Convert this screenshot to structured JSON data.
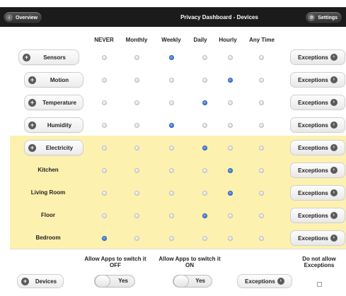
{
  "header": {
    "back_label": "Overview",
    "title": "Privacy Dashboard - Devices",
    "settings_label": "Settings"
  },
  "columns": [
    "NEVER",
    "Monthly",
    "Weekly",
    "Daily",
    "Hourly",
    "Any Time"
  ],
  "rows": [
    {
      "label": "Sensors",
      "style": "button",
      "selected": 2,
      "exceptions": "Exceptions"
    },
    {
      "label": "Motion",
      "style": "button",
      "selected": 4,
      "exceptions": "Exceptions"
    },
    {
      "label": "Temperature",
      "style": "button",
      "selected": 3,
      "exceptions": "Exceptions"
    },
    {
      "label": "Humidity",
      "style": "button",
      "selected": 2,
      "exceptions": "Exceptions"
    },
    {
      "label": "Electricity",
      "style": "button",
      "selected": 3,
      "exceptions": "Exceptions"
    },
    {
      "label": "Kitchen",
      "style": "plain",
      "selected": 4,
      "exceptions": "Exceptions"
    },
    {
      "label": "Living Room",
      "style": "plain",
      "selected": 4,
      "exceptions": "Exceptions"
    },
    {
      "label": "Floor",
      "style": "plain",
      "selected": 3,
      "exceptions": "Exceptions"
    },
    {
      "label": "Bedroom",
      "style": "plain",
      "selected": 0,
      "exceptions": "Exceptions"
    }
  ],
  "footer": {
    "allow_off_line1": "Allow Apps to switch it",
    "allow_off_line2": "OFF",
    "allow_on_line1": "Allow Apps to switch it",
    "allow_on_line2": "ON",
    "no_exceptions_line1": "Do not allow",
    "no_exceptions_line2": "Exceptions",
    "devices_label": "Devices",
    "toggle_off_value": "Yes",
    "toggle_on_value": "Yes",
    "exceptions_label": "Exceptions"
  },
  "colors": {
    "header_bg": "#1b1b1b",
    "highlight_bg": "#fdf1b0",
    "radio_selected": "#2a63c8"
  },
  "icons": {
    "back": "chevron-left-icon",
    "settings": "gear-icon",
    "expand": "plus-circle-icon",
    "exceptions": "arrow-right-circle-icon"
  }
}
